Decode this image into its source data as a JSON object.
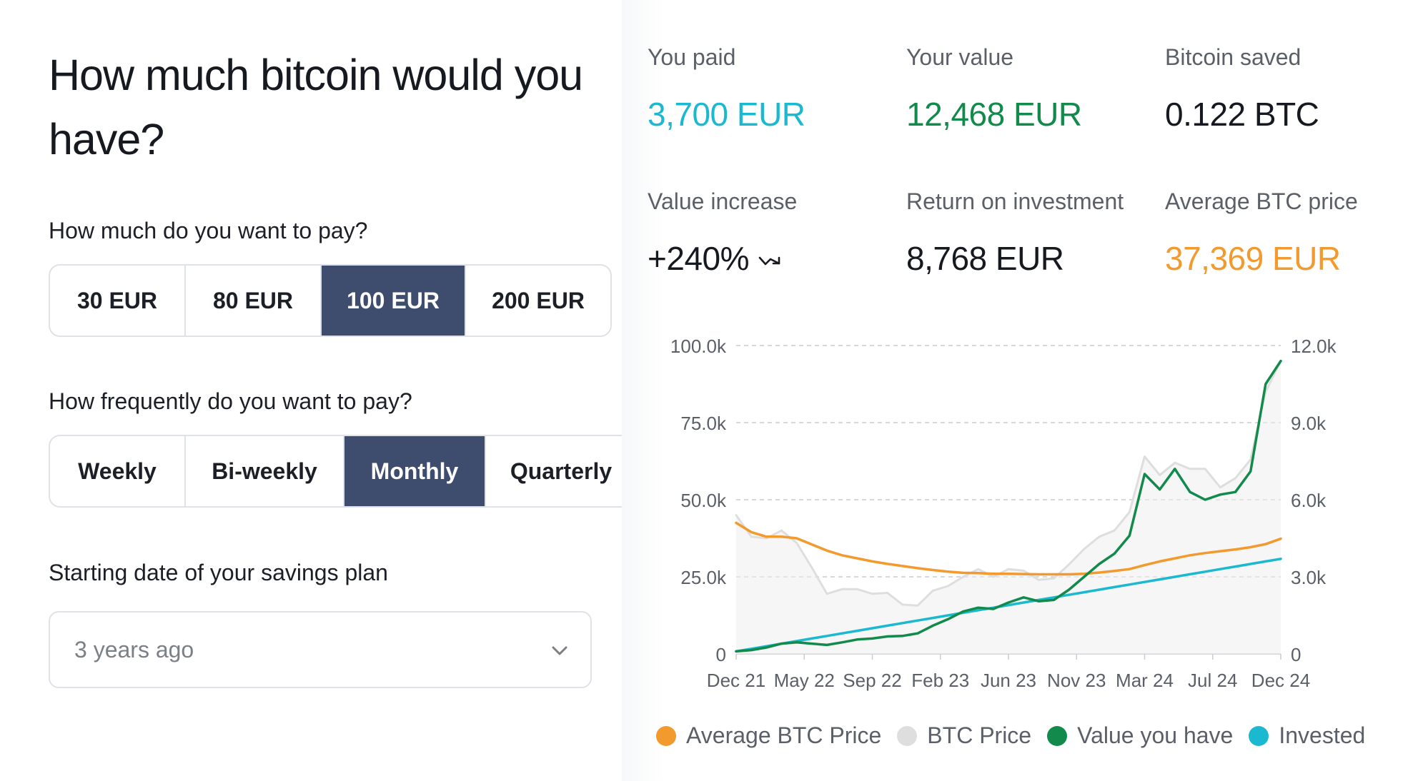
{
  "title": "How much bitcoin would you have?",
  "amount": {
    "question": "How much do you want to pay?",
    "options": [
      "30 EUR",
      "80 EUR",
      "100 EUR",
      "200 EUR"
    ],
    "selected": "100 EUR"
  },
  "frequency": {
    "question": "How frequently do you want to pay?",
    "options": [
      "Weekly",
      "Bi-weekly",
      "Monthly",
      "Quarterly"
    ],
    "selected": "Monthly"
  },
  "start_date": {
    "label": "Starting date of your savings plan",
    "value": "3 years ago"
  },
  "stats": {
    "paid": {
      "label": "You paid",
      "value": "3,700 EUR",
      "color": "#1bb9cf"
    },
    "value": {
      "label": "Your value",
      "value": "12,468 EUR",
      "color": "#128a4c"
    },
    "saved": {
      "label": "Bitcoin saved",
      "value": "0.122 BTC"
    },
    "increase": {
      "label": "Value increase",
      "value": "+240%"
    },
    "roi": {
      "label": "Return on investment",
      "value": "8,768 EUR"
    },
    "avg_price": {
      "label": "Average BTC price",
      "value": "37,369 EUR",
      "color": "#f29a2e"
    }
  },
  "chart_data": {
    "type": "line",
    "x_ticks": [
      "Dec 21",
      "May 22",
      "Sep 22",
      "Feb 23",
      "Jun 23",
      "Nov 23",
      "Mar 24",
      "Jul 24",
      "Dec 24"
    ],
    "y_left_ticks": [
      "100.0k",
      "75.0k",
      "50.0k",
      "25.0k",
      "0"
    ],
    "y_right_ticks": [
      "12.0k",
      "9.0k",
      "6.0k",
      "3.0k",
      "0"
    ],
    "y_left_range": [
      0,
      100000
    ],
    "y_right_range": [
      0,
      12000
    ],
    "grid": true,
    "legend_position": "bottom",
    "series": [
      {
        "name": "Average BTC Price",
        "axis": "left",
        "color": "#f29a2e",
        "x": [
          "2021-12",
          "2022-01",
          "2022-02",
          "2022-03",
          "2022-04",
          "2022-05",
          "2022-06",
          "2022-07",
          "2022-08",
          "2022-09",
          "2022-10",
          "2022-11",
          "2022-12",
          "2023-01",
          "2023-02",
          "2023-03",
          "2023-04",
          "2023-05",
          "2023-06",
          "2023-07",
          "2023-08",
          "2023-09",
          "2023-10",
          "2023-11",
          "2023-12",
          "2024-01",
          "2024-02",
          "2024-03",
          "2024-04",
          "2024-05",
          "2024-06",
          "2024-07",
          "2024-08",
          "2024-09",
          "2024-10",
          "2024-11",
          "2024-12"
        ],
        "y": [
          42500,
          39500,
          38000,
          38000,
          37500,
          35500,
          33500,
          32000,
          31000,
          30000,
          29200,
          28500,
          27800,
          27200,
          26700,
          26300,
          26200,
          26000,
          26000,
          25900,
          25800,
          25800,
          25800,
          26000,
          26400,
          26900,
          27500,
          28800,
          30000,
          31000,
          32000,
          32700,
          33300,
          33900,
          34600,
          35600,
          37369
        ]
      },
      {
        "name": "BTC Price",
        "axis": "left",
        "color": "#dedede",
        "x": [
          "2021-12",
          "2022-01",
          "2022-02",
          "2022-03",
          "2022-04",
          "2022-05",
          "2022-06",
          "2022-07",
          "2022-08",
          "2022-09",
          "2022-10",
          "2022-11",
          "2022-12",
          "2023-01",
          "2023-02",
          "2023-03",
          "2023-04",
          "2023-05",
          "2023-06",
          "2023-07",
          "2023-08",
          "2023-09",
          "2023-10",
          "2023-11",
          "2023-12",
          "2024-01",
          "2024-02",
          "2024-03",
          "2024-04",
          "2024-05",
          "2024-06",
          "2024-07",
          "2024-08",
          "2024-09",
          "2024-10",
          "2024-11",
          "2024-12"
        ],
        "y": [
          45000,
          38000,
          37500,
          40000,
          36000,
          28000,
          19500,
          21000,
          21000,
          19500,
          19800,
          16000,
          15700,
          20500,
          22000,
          25000,
          27500,
          25000,
          27500,
          27000,
          24000,
          24500,
          29000,
          34000,
          38000,
          40000,
          46000,
          64000,
          58000,
          62000,
          60000,
          60000,
          54000,
          57000,
          63000,
          85000,
          95000
        ]
      },
      {
        "name": "Value you have",
        "axis": "right",
        "color": "#128a4c",
        "x": [
          "2021-12",
          "2022-01",
          "2022-02",
          "2022-03",
          "2022-04",
          "2022-05",
          "2022-06",
          "2022-07",
          "2022-08",
          "2022-09",
          "2022-10",
          "2022-11",
          "2022-12",
          "2023-01",
          "2023-02",
          "2023-03",
          "2023-04",
          "2023-05",
          "2023-06",
          "2023-07",
          "2023-08",
          "2023-09",
          "2023-10",
          "2023-11",
          "2023-12",
          "2024-01",
          "2024-02",
          "2024-03",
          "2024-04",
          "2024-05",
          "2024-06",
          "2024-07",
          "2024-08",
          "2024-09",
          "2024-10",
          "2024-11",
          "2024-12"
        ],
        "y": [
          100,
          150,
          250,
          400,
          450,
          400,
          350,
          450,
          560,
          600,
          680,
          700,
          800,
          1100,
          1350,
          1650,
          1800,
          1750,
          2000,
          2200,
          2050,
          2100,
          2500,
          3000,
          3500,
          3900,
          4600,
          7000,
          6400,
          7200,
          6300,
          6000,
          6200,
          6300,
          7100,
          10500,
          11400
        ]
      },
      {
        "name": "Invested",
        "axis": "right",
        "color": "#1bb9cf",
        "x": [
          "2021-12",
          "2022-01",
          "2022-02",
          "2022-03",
          "2022-04",
          "2022-05",
          "2022-06",
          "2022-07",
          "2022-08",
          "2022-09",
          "2022-10",
          "2022-11",
          "2022-12",
          "2023-01",
          "2023-02",
          "2023-03",
          "2023-04",
          "2023-05",
          "2023-06",
          "2023-07",
          "2023-08",
          "2023-09",
          "2023-10",
          "2023-11",
          "2023-12",
          "2024-01",
          "2024-02",
          "2024-03",
          "2024-04",
          "2024-05",
          "2024-06",
          "2024-07",
          "2024-08",
          "2024-09",
          "2024-10",
          "2024-11",
          "2024-12"
        ],
        "y": [
          100,
          200,
          300,
          400,
          500,
          600,
          700,
          800,
          900,
          1000,
          1100,
          1200,
          1300,
          1400,
          1500,
          1600,
          1700,
          1800,
          1900,
          2000,
          2100,
          2200,
          2300,
          2400,
          2500,
          2600,
          2700,
          2800,
          2900,
          3000,
          3100,
          3200,
          3300,
          3400,
          3500,
          3600,
          3700
        ]
      }
    ]
  }
}
